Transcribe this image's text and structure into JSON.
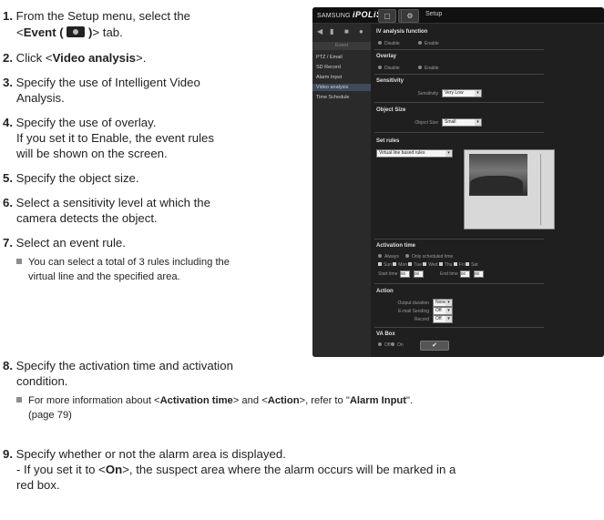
{
  "steps": [
    {
      "num": "1.",
      "pre": "From the Setup menu, select the",
      "line2_pre": "<",
      "bold": "Event (",
      "bold2": ")",
      "line2_post": "> tab."
    },
    {
      "num": "2.",
      "pre": "Click <",
      "bold": "Video analysis",
      "post": ">."
    },
    {
      "num": "3.",
      "line1": "Specify the use of Intelligent Video",
      "line2": "Analysis."
    },
    {
      "num": "4.",
      "line1": "Specify the use of overlay.",
      "line2": "If you set it to Enable, the event rules",
      "line3": "will be shown on the screen."
    },
    {
      "num": "5.",
      "line1": "Specify the object size."
    },
    {
      "num": "6.",
      "line1": "Select a sensitivity level at which the",
      "line2": "camera detects the object."
    },
    {
      "num": "7.",
      "line1": "Select an event rule."
    },
    {
      "num": "8.",
      "line1": "Specify the activation time and activation",
      "line2": "condition."
    },
    {
      "num": "9.",
      "line1": "Specify whether or not the alarm area is displayed.",
      "line2": "- If you set it to <",
      "bold": "On",
      "line2_post": ">, the suspect area where the alarm occurs will be marked in a",
      "line3": "red box."
    }
  ],
  "note7": {
    "line1": "You can select a total of 3 rules including the",
    "line2": "virtual line and the specified area."
  },
  "note8": {
    "pre": "For more information about <",
    "b1": "Activation time",
    "mid": "> and <",
    "b2": "Action",
    "mid2": ">, refer to \"",
    "b3": "Alarm Input",
    "post": "\".",
    "line2": "(page 79)"
  },
  "screenshot": {
    "logo_small": "SAMSUNG",
    "logo_big": "iPOLiS",
    "setup": "Setup",
    "sidebar_header": "Event",
    "sidebar_items": [
      "PTZ / Email",
      "SD Record",
      "Alarm Input",
      "Video analysis",
      "Time Schedule"
    ],
    "sections": {
      "iv": "IV analysis function",
      "overlay": "Overlay",
      "sensitivity": "Sensitivity",
      "object_size": "Object Size",
      "set_rules": "Set rules",
      "activation_time": "Activation time",
      "action": "Action",
      "va_box": "VA Box"
    },
    "radios": {
      "disable": "Disable",
      "enable": "Enable",
      "always": "Always",
      "only_scheduled": "Only scheduled time",
      "off": "Off",
      "on": "On"
    },
    "labels": {
      "sensitivity": "Sensitivity",
      "object_size": "Object Size",
      "start_time": "Start time",
      "end_time": "End time",
      "output_duration": "Output duration",
      "email_sending": "E-mail Sending",
      "record": "Record"
    },
    "values": {
      "sensitivity": "Very Low",
      "object_size": "Small",
      "rule": "Virtual line based rules",
      "start_h": "00",
      "start_m": "00",
      "end_h": "00",
      "end_m": "00",
      "output_duration": "None",
      "email_sending": "Off",
      "record": "Off"
    },
    "days": [
      "Sun",
      "Mon",
      "Tue",
      "Wed",
      "Thu",
      "Fri",
      "Sat"
    ],
    "ok": "✔"
  }
}
